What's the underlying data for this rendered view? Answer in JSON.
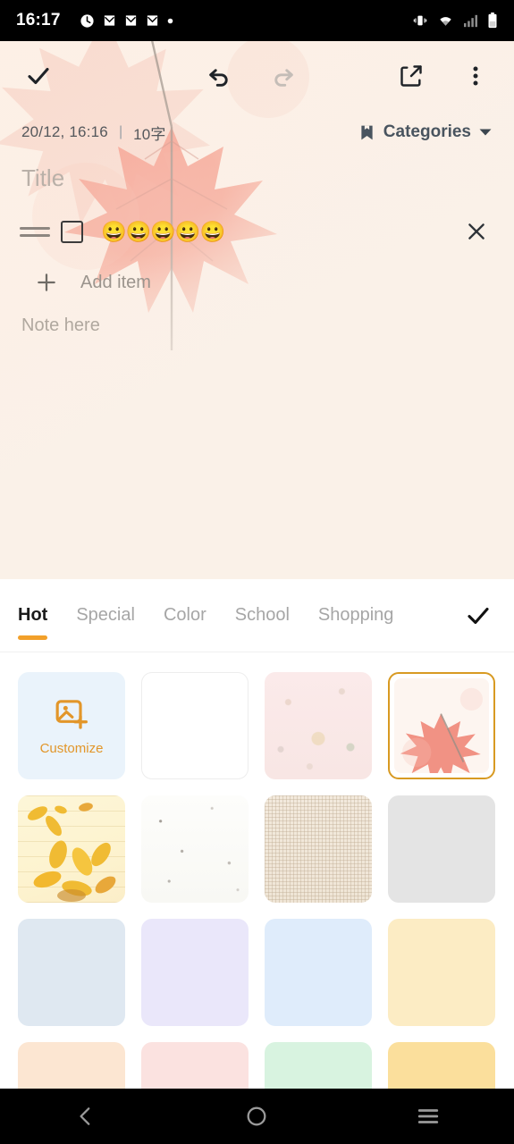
{
  "status_bar": {
    "time": "16:17",
    "left_icons": [
      "clock-icon",
      "mail-icon",
      "mail-icon",
      "mail-icon",
      "dot-icon"
    ],
    "right_icons": [
      "vibrate-icon",
      "wifi-icon",
      "signal-icon",
      "battery-icon"
    ]
  },
  "editor": {
    "toolbar": {
      "confirm_label": "done-check",
      "undo_label": "undo",
      "redo_label": "redo",
      "share_label": "share",
      "more_label": "more-options"
    },
    "meta": {
      "date": "20/12, 16:16",
      "separator": "|",
      "word_count": "10字",
      "categories_label": "Categories"
    },
    "title_placeholder": "Title",
    "checklist": [
      {
        "text": "😀😀😀😀😀",
        "checked": false
      }
    ],
    "add_item_label": "Add item",
    "note_placeholder": "Note here"
  },
  "background_picker": {
    "tabs": [
      {
        "label": "Hot",
        "active": true
      },
      {
        "label": "Special",
        "active": false
      },
      {
        "label": "Color",
        "active": false
      },
      {
        "label": "School",
        "active": false
      },
      {
        "label": "Shopping",
        "active": false
      }
    ],
    "confirm_label": "apply-check",
    "accent_color": "#f2a02a",
    "selected_border_color": "#d89a22",
    "customize": {
      "label": "Customize",
      "icon": "add-image-icon",
      "background_color": "#eaf3fb",
      "icon_color": "#e2962a"
    },
    "swatches": [
      {
        "name": "customize",
        "kind": "customize",
        "selected": false
      },
      {
        "name": "blank-white",
        "kind": "solid",
        "color": "#ffffff",
        "selected": false
      },
      {
        "name": "pink-floral",
        "kind": "pattern",
        "pattern": "floral",
        "color": "#fbeaea",
        "selected": false
      },
      {
        "name": "red-maple-leaf",
        "kind": "image",
        "pattern": "maple-leaf",
        "color": "#fdf4ee",
        "selected": true
      },
      {
        "name": "yellow-leaves-lined",
        "kind": "image",
        "pattern": "yellow-leaves",
        "color": "#fdf3cf",
        "selected": false
      },
      {
        "name": "white-speckled-paper",
        "kind": "pattern",
        "pattern": "speckle",
        "color": "#fbfbf8",
        "selected": false
      },
      {
        "name": "beige-woven",
        "kind": "pattern",
        "pattern": "woven",
        "color": "#f0e6d8",
        "selected": false
      },
      {
        "name": "light-gray",
        "kind": "solid",
        "color": "#e4e4e4",
        "selected": false
      },
      {
        "name": "pale-blue-gray",
        "kind": "solid",
        "color": "#dfe8f1",
        "selected": false
      },
      {
        "name": "lavender",
        "kind": "solid",
        "color": "#eae7fa",
        "selected": false
      },
      {
        "name": "light-blue",
        "kind": "solid",
        "color": "#dfecfb",
        "selected": false
      },
      {
        "name": "pale-yellow",
        "kind": "solid",
        "color": "#fcecc4",
        "selected": false
      },
      {
        "name": "peach",
        "kind": "solid",
        "color": "#fce6d2",
        "selected": false
      },
      {
        "name": "blush-pink",
        "kind": "solid",
        "color": "#fbe2e0",
        "selected": false
      },
      {
        "name": "mint-green",
        "kind": "solid",
        "color": "#d8f3e0",
        "selected": false
      },
      {
        "name": "golden-yellow",
        "kind": "solid",
        "color": "#fbdf9c",
        "selected": false
      }
    ]
  },
  "nav_bar": {
    "back_label": "back",
    "home_label": "home",
    "recents_label": "recents"
  }
}
